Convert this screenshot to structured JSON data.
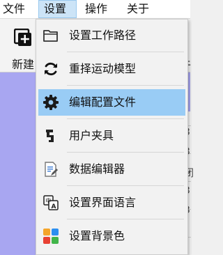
{
  "menubar": {
    "items": [
      {
        "label": "文件"
      },
      {
        "label": "设置"
      },
      {
        "label": "操作"
      },
      {
        "label": "关于"
      }
    ],
    "active_index": 1
  },
  "toolbar": {
    "new_label": "新建",
    "new_icon": "new-file-icon",
    "right_partial_label": "牛"
  },
  "right_panel": {
    "glyphs": [
      "3",
      "3",
      "闭",
      "3",
      "3"
    ]
  },
  "settings_menu": {
    "items": [
      {
        "label": "设置工作路径",
        "icon": "folder-icon"
      },
      {
        "label": "重择运动模型",
        "icon": "refresh-icon"
      },
      {
        "label": "编辑配置文件",
        "icon": "gear-icon",
        "highlighted": true
      },
      {
        "label": "用户夹具",
        "icon": "clamp-icon"
      },
      {
        "label": "数据编辑器",
        "icon": "data-edit-icon"
      },
      {
        "label": "设置界面语言",
        "icon": "language-icon"
      },
      {
        "label": "设置背景色",
        "icon": "color-palette-icon"
      }
    ]
  },
  "colors": {
    "highlight": "#99ccf5",
    "background_area": "#a8a6f1",
    "menu_bg": "#f2f2f2"
  }
}
